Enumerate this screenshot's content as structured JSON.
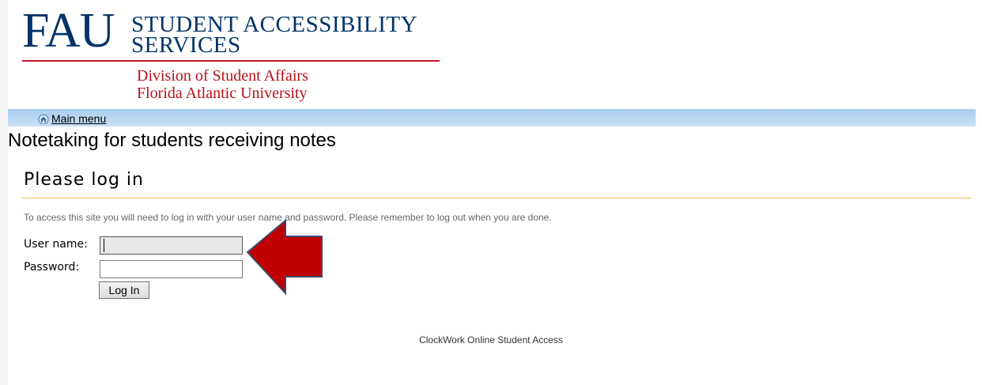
{
  "logo": {
    "mark": "FAU",
    "title_line1": "STUDENT ACCESSIBILITY",
    "title_line2": "SERVICES",
    "sub_line1": "Division of Student Affairs",
    "sub_line2": "Florida Atlantic University"
  },
  "nav": {
    "main_menu_label": "Main menu",
    "home_icon": "home-icon"
  },
  "page_title": "Notetaking for students receiving notes",
  "login": {
    "heading": "Please log in",
    "instructions": "To access this site you will need to log in with your user name and password. Please remember to log out when you are done.",
    "username_label": "User name:",
    "username_value": "",
    "password_label": "Password:",
    "password_value": "",
    "submit_label": "Log In"
  },
  "annotation": {
    "arrow_color": "#c00000",
    "arrow_outline": "#3a4a6b"
  },
  "footer": {
    "text": "ClockWork Online Student Access"
  },
  "colors": {
    "brand_blue": "#003366",
    "brand_red": "#c8102e",
    "nav_bar": "#b8d6f0",
    "section_rule": "#f2b64a"
  }
}
